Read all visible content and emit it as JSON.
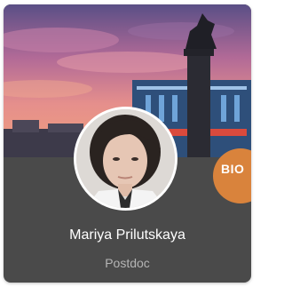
{
  "profile": {
    "name": "Mariya Prilutskaya",
    "role": "Postdoc",
    "badge_label": "BIO"
  },
  "colors": {
    "card_background": "#4a4a4a",
    "badge": "#d9833c",
    "name_text": "#ffffff",
    "role_text": "#b5b5b5"
  }
}
